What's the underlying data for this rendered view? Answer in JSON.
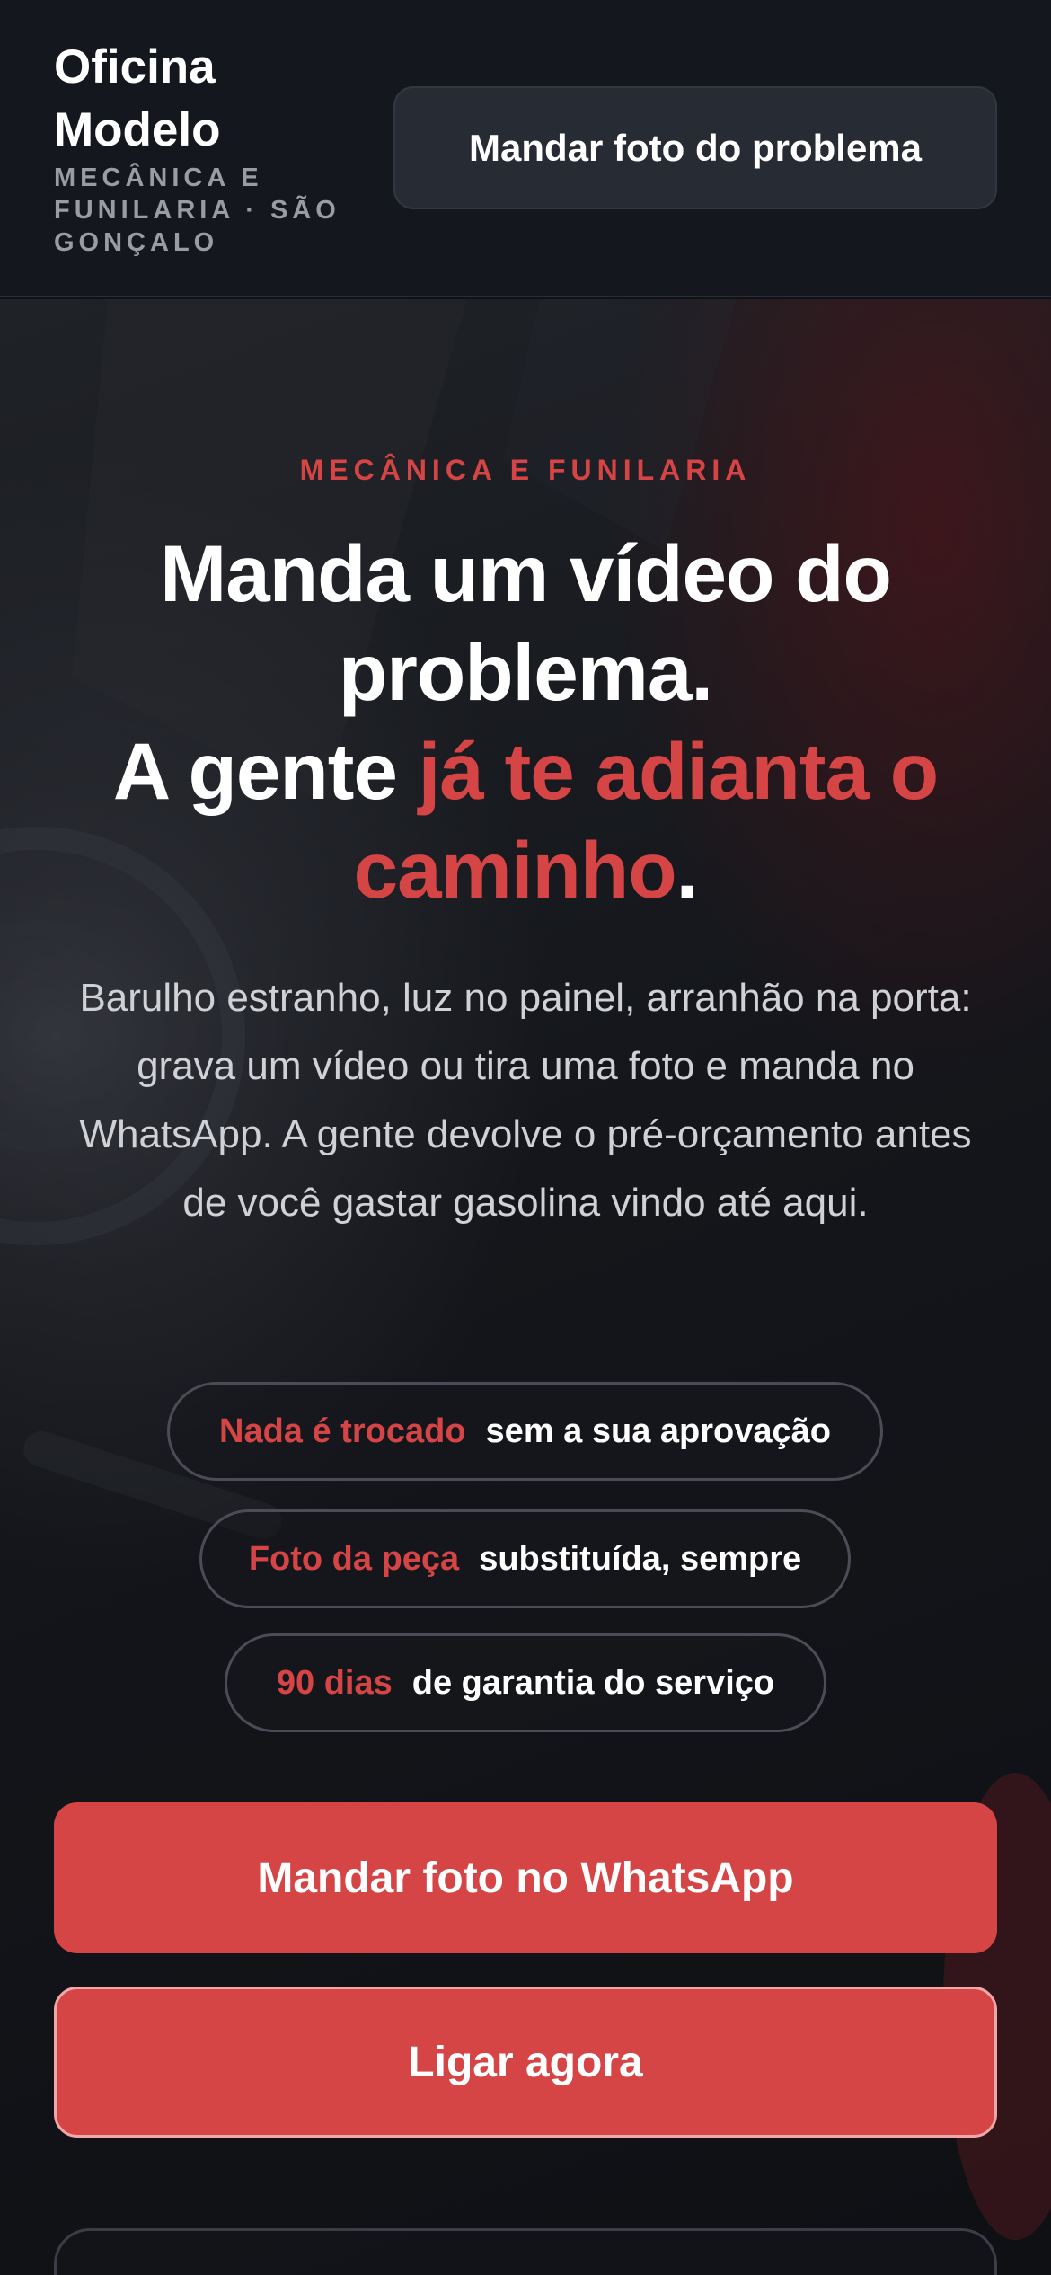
{
  "header": {
    "brand_name": "Oficina Modelo",
    "brand_tagline": "MECÂNICA E FUNILARIA · SÃO GONÇALO",
    "photo_button_label": "Mandar foto do problema"
  },
  "hero": {
    "eyebrow": "MECÂNICA E FUNILARIA",
    "headline_part1": "Manda um vídeo do problema.",
    "headline_part2": "A gente ",
    "headline_accent": "já te adianta o caminho",
    "headline_end": ".",
    "lead": "Barulho estranho, luz no painel, arranhão na porta: grava um vídeo ou tira uma foto e manda no WhatsApp. A gente devolve o pré-orçamento antes de você gastar gasolina vindo até aqui.",
    "badges": [
      {
        "strong": "Nada é trocado",
        "rest": "sem a sua aprovação"
      },
      {
        "strong": "Foto da peça",
        "rest": "substituída, sempre"
      },
      {
        "strong": "90 dias",
        "rest": "de garantia do serviço"
      }
    ],
    "whatsapp_button_label": "Mandar foto no WhatsApp",
    "call_button_label": "Ligar agora"
  },
  "colors": {
    "accent": "#d64545",
    "background": "#0f1217",
    "header_background": "#14171d"
  }
}
